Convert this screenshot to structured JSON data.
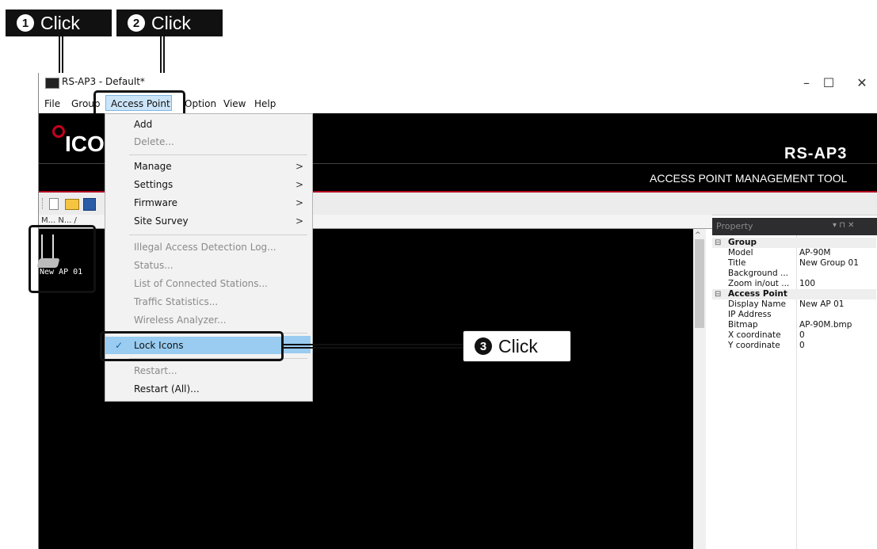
{
  "callouts": {
    "step1": {
      "number": "1",
      "label": "Click"
    },
    "step2": {
      "number": "2",
      "label": "Click"
    },
    "step3": {
      "number": "3",
      "label": "Click"
    }
  },
  "window": {
    "title": "RS-AP3 - Default*",
    "controls": {
      "minimize": "–",
      "maximize": "☐",
      "close": "✕"
    }
  },
  "menubar": {
    "file": "File",
    "group": "Group",
    "access_point": "Access Point",
    "option": "Option",
    "view": "View",
    "help": "Help"
  },
  "banner": {
    "logo": "ICOM",
    "product": "RS-AP3",
    "subtitle": "ACCESS POINT MANAGEMENT TOOL"
  },
  "dropdown": {
    "items": [
      {
        "label": "Add",
        "enabled": true
      },
      {
        "label": "Delete...",
        "enabled": false
      },
      {
        "label": "Manage",
        "enabled": true,
        "submenu": true
      },
      {
        "label": "Settings",
        "enabled": true,
        "submenu": true
      },
      {
        "label": "Firmware",
        "enabled": true,
        "submenu": true
      },
      {
        "label": "Site Survey",
        "enabled": true,
        "submenu": true
      },
      {
        "label": "Illegal Access Detection Log...",
        "enabled": false
      },
      {
        "label": "Status...",
        "enabled": false
      },
      {
        "label": "List of Connected Stations...",
        "enabled": false
      },
      {
        "label": "Traffic Statistics...",
        "enabled": false
      },
      {
        "label": "Wireless Analyzer...",
        "enabled": false
      },
      {
        "label": "Lock Icons",
        "enabled": true,
        "checked": true,
        "check_mark": "✓"
      },
      {
        "label": "Restart...",
        "enabled": false
      },
      {
        "label": "Restart (All)...",
        "enabled": true
      }
    ],
    "submenu_arrow": ">"
  },
  "canvas": {
    "ap_icon_label": "New AP 01",
    "tab_fragment": "M... N... /"
  },
  "property": {
    "title": "Property",
    "title_buttons": "▾ ⊓ ✕",
    "categories": [
      {
        "name": "Group",
        "rows": [
          {
            "key": "Model",
            "value": "AP-90M"
          },
          {
            "key": "Title",
            "value": "New Group 01"
          },
          {
            "key": "Background ...",
            "value": ""
          },
          {
            "key": "Zoom in/out ...",
            "value": "100"
          }
        ]
      },
      {
        "name": "Access Point",
        "rows": [
          {
            "key": "Display Name",
            "value": "New AP 01"
          },
          {
            "key": "IP Address",
            "value": ""
          },
          {
            "key": "Bitmap",
            "value": "AP-90M.bmp"
          },
          {
            "key": "X coordinate",
            "value": "0"
          },
          {
            "key": "Y coordinate",
            "value": "0"
          }
        ]
      }
    ],
    "collapse_glyph": "⊟"
  },
  "colors": {
    "banner": "#000000",
    "highlight": "#99ccf0",
    "property_title": "#2d2d30",
    "property_category": "#eeeeee"
  }
}
